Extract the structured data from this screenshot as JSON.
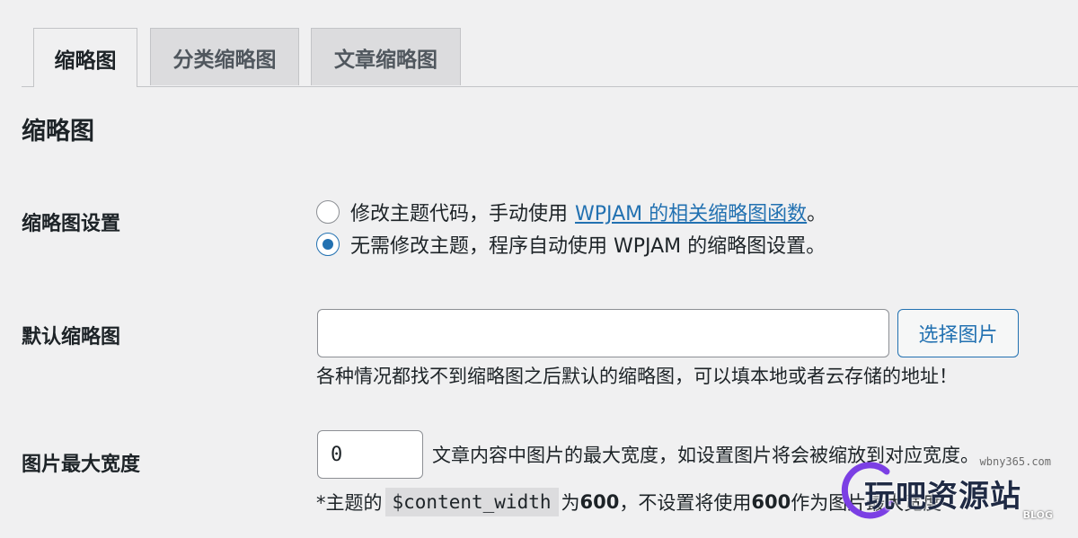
{
  "tabs": [
    {
      "label": "缩略图",
      "active": true
    },
    {
      "label": "分类缩略图",
      "active": false
    },
    {
      "label": "文章缩略图",
      "active": false
    }
  ],
  "section_title": "缩略图",
  "thumbnail_setting": {
    "label": "缩略图设置",
    "option1_prefix": "修改主题代码，手动使用",
    "option1_link": "WPJAM 的相关缩略图函数",
    "option1_suffix": "。",
    "option2": "无需修改主题，程序自动使用 WPJAM 的缩略图设置。",
    "selected": 2
  },
  "default_thumbnail": {
    "label": "默认缩略图",
    "value": "",
    "button": "选择图片",
    "description": "各种情况都找不到缩略图之后默认的缩略图，可以填本地或者云存储的地址！"
  },
  "max_width": {
    "label": "图片最大宽度",
    "value": "0",
    "description": "文章内容中图片的最大宽度，如设置图片将会被缩放到对应宽度。",
    "note_prefix": "*主题的",
    "note_code": "$content_width",
    "note_mid": "为",
    "note_value1": "600",
    "note_text2": "，不设置将使用",
    "note_value2": "600",
    "note_suffix": "作为图片最大宽度"
  },
  "watermark": {
    "url": "wbny365.com",
    "title": "玩吧资源站",
    "sub": "BLOG"
  },
  "colors": {
    "accent": "#2271b1",
    "background": "#f0f0f1"
  }
}
